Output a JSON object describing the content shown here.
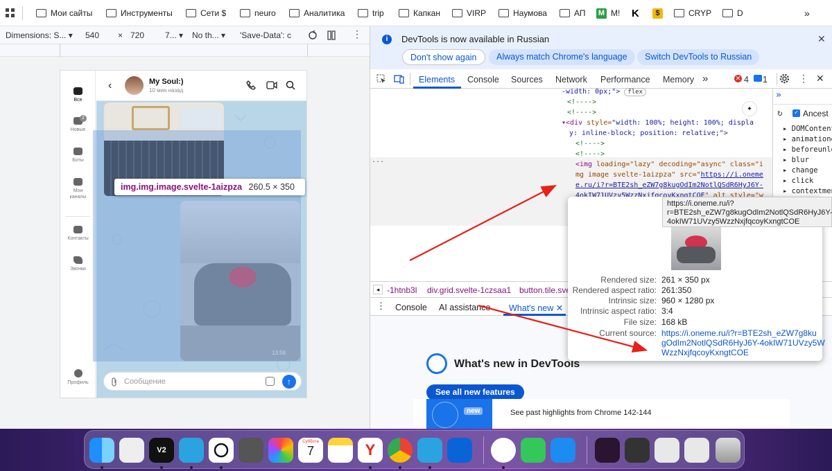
{
  "bookmarks": {
    "items": [
      "Мои сайты",
      "Инструменты",
      "Сети $",
      "neuro",
      "Аналитика",
      "trip",
      "Капкан",
      "VIRP",
      "Наумова",
      "АП",
      "M!",
      "",
      "",
      "CRYP",
      "D"
    ]
  },
  "device_toolbar": {
    "dimensions": "Dimensions: S...",
    "width": "540",
    "times": "×",
    "height": "720",
    "dpr": "7...",
    "throttle": "No th...",
    "save_data": "'Save-Data': c"
  },
  "phone": {
    "contact_name": "My Soul:)",
    "last_seen": "10 мин назад",
    "nav": {
      "all": "Все",
      "new": "Новые",
      "new_badge": "2",
      "bots": "Боты",
      "channels_1": "Мои",
      "channels_2": "каналы",
      "contacts": "Контакты",
      "calls": "Звонки",
      "profile": "Профиль"
    },
    "message_time": "13:58",
    "compose_placeholder": "Сообщение"
  },
  "element_tooltip": {
    "selector": "img.img.image.svelte-1aizpza",
    "size": "260.5 × 350"
  },
  "devtools": {
    "infobar": {
      "message": "DevTools is now available in Russian",
      "btn_dont_show": "Don't show again",
      "btn_match": "Always match Chrome's language",
      "btn_switch": "Switch DevTools to Russian"
    },
    "tabs": [
      "Elements",
      "Console",
      "Sources",
      "Network",
      "Performance",
      "Memory"
    ],
    "errors": "4",
    "messages": "1",
    "tree": {
      "l1": "-width: 0px;\">",
      "flex": "flex",
      "l2": "<!---->",
      "l3": "<!---->",
      "l4a": "<div ",
      "l4b": "style=",
      "l4c": "\"width: 100%; height: 100%; displa",
      "l5": "y: inline-block; position: relative;\">",
      "l6": "<!---->",
      "l7": "<!---->",
      "l8a": "<img ",
      "l8b": "loading=\"lazy\" decoding=\"async\" class=\"i",
      "l9": "mg image svelte-1aizpza\" src=\"",
      "l9b": "https://i.oneme",
      "l10": "e.ru/i?r=BTE2sh_eZW7g8kugOdIm2NotlQSdR6HyJ6Y-",
      "l11": "4okIW71UVzy5WzzNxjfqcoyKxngtCOE",
      "l11b": "\" alt style=\"w",
      "dots": "..."
    },
    "breadcrumb": [
      "-1htnb3l",
      "div.grid.svelte-1czsaa1",
      "button.tile.sve"
    ],
    "drawer_tabs": [
      "Console",
      "AI assistance",
      "What's new"
    ],
    "whats_new": {
      "title": "What's new in DevTools",
      "see_all": "See all new features",
      "badge": "new",
      "highlights": "See past highlights from Chrome 142-144"
    },
    "sidebar": {
      "ancestors": "Ancest",
      "events": [
        "DOMContent",
        "animatione",
        "beforeunlo",
        "blur",
        "change",
        "click",
        "contextmen"
      ]
    },
    "image_popup": {
      "rendered_size_label": "Rendered size:",
      "rendered_size": "261 × 350 px",
      "aspect_label": "Rendered aspect ratio:",
      "aspect": "261:350",
      "intrinsic_label": "Intrinsic size:",
      "intrinsic": "960 × 1280 px",
      "intrinsic_aspect_label": "Intrinsic aspect ratio:",
      "intrinsic_aspect": "3:4",
      "file_size_label": "File size:",
      "file_size": "168 kB",
      "source_label": "Current source:",
      "source_1": "https://i.oneme.ru/i?r=BTE2sh_eZW7g8ku",
      "source_2": "gOdIm2NotlQSdR6HyJ6Y-4okIW71UVzy5W",
      "source_3": "WzzNxjfqcoyKxngtCOE"
    },
    "url_tooltip": {
      "line1": "https://i.oneme.ru/i?",
      "line2": "r=BTE2sh_eZW7g8kugOdIm2NotlQSdR6HyJ6Y-",
      "line3": "4okIW71UVzy5WzzNxjfqcoyKxngtCOE"
    }
  },
  "dock": {
    "calendar_day": "Суббота",
    "calendar_date": "7",
    "v2": "V2"
  },
  "colors": {
    "accent": "#0b57d0",
    "arrow": "#e8201a",
    "chat_bg": "#b9d6e8",
    "highlight": "#78a0d7"
  }
}
